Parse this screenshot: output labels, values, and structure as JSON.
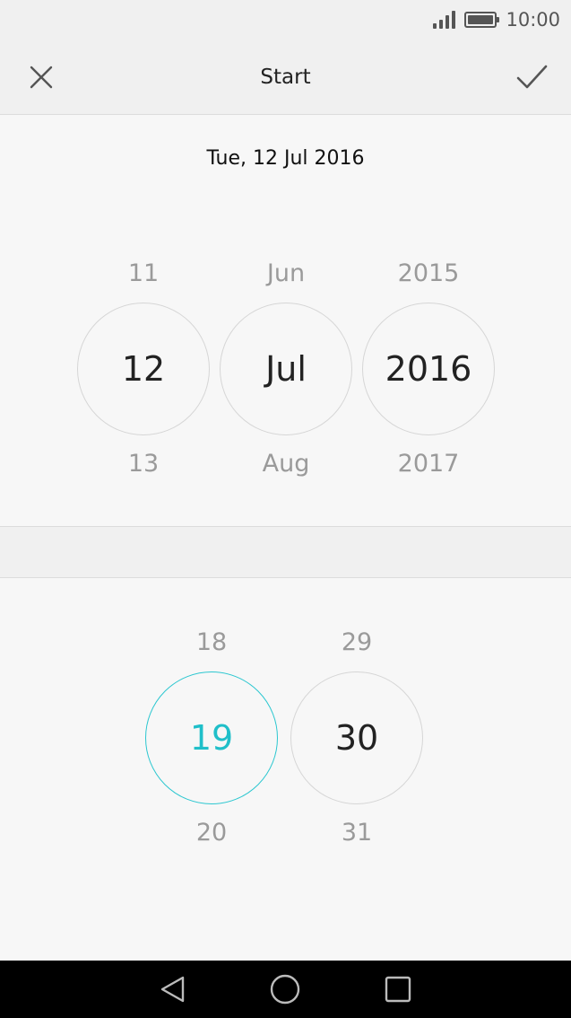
{
  "status_bar": {
    "time": "10:00"
  },
  "header": {
    "title": "Start"
  },
  "date_summary": "Tue, 12 Jul 2016",
  "date_picker": {
    "day": {
      "prev": "11",
      "selected": "12",
      "next": "13"
    },
    "month": {
      "prev": "Jun",
      "selected": "Jul",
      "next": "Aug"
    },
    "year": {
      "prev": "2015",
      "selected": "2016",
      "next": "2017"
    }
  },
  "time_picker": {
    "hour": {
      "prev": "18",
      "selected": "19",
      "next": "20"
    },
    "minute": {
      "prev": "29",
      "selected": "30",
      "next": "31"
    }
  },
  "colors": {
    "accent": "#1fbfc9",
    "background": "#f7f7f7",
    "bar": "#f0f0f0"
  },
  "icons": {
    "close": "close-icon",
    "confirm": "checkmark-icon",
    "back": "nav-back-icon",
    "home": "nav-home-icon",
    "recents": "nav-recents-icon"
  }
}
